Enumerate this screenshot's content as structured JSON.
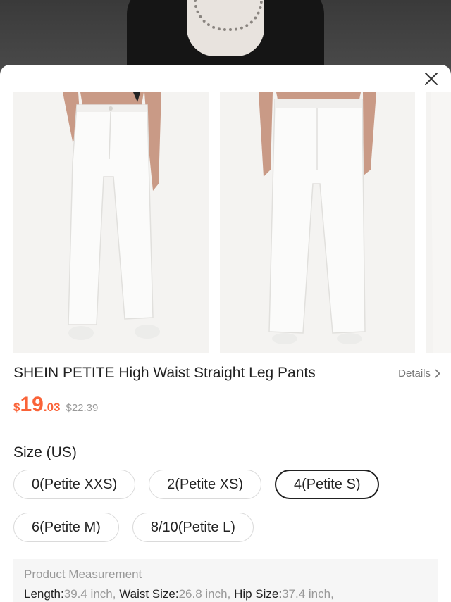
{
  "product": {
    "title": "SHEIN PETITE High Waist Straight Leg Pants",
    "details_label": "Details",
    "price": {
      "currency": "$",
      "integer": "19",
      "decimal": ".03",
      "original": "$22.39"
    },
    "images": [
      {
        "alt": "front view white pants"
      },
      {
        "alt": "back view white pants"
      },
      {
        "alt": "third view partially visible"
      }
    ]
  },
  "size": {
    "label": "Size (US)",
    "options": [
      "0(Petite XXS)",
      "2(Petite XS)",
      "4(Petite S)",
      "6(Petite M)",
      "8/10(Petite L)"
    ],
    "selected": "4(Petite S)"
  },
  "measurement": {
    "title": "Product Measurement",
    "items": [
      {
        "label": "Length:",
        "value": "39.4 inch,"
      },
      {
        "label": "Waist Size:",
        "value": "26.8 inch,"
      },
      {
        "label": "Hip Size:",
        "value": "37.4 inch,"
      }
    ]
  },
  "colors": {
    "accent": "#fa6338",
    "text": "#222222",
    "muted": "#999999"
  },
  "icons": {
    "close": "close-icon",
    "details": "chevron-right-icon"
  }
}
